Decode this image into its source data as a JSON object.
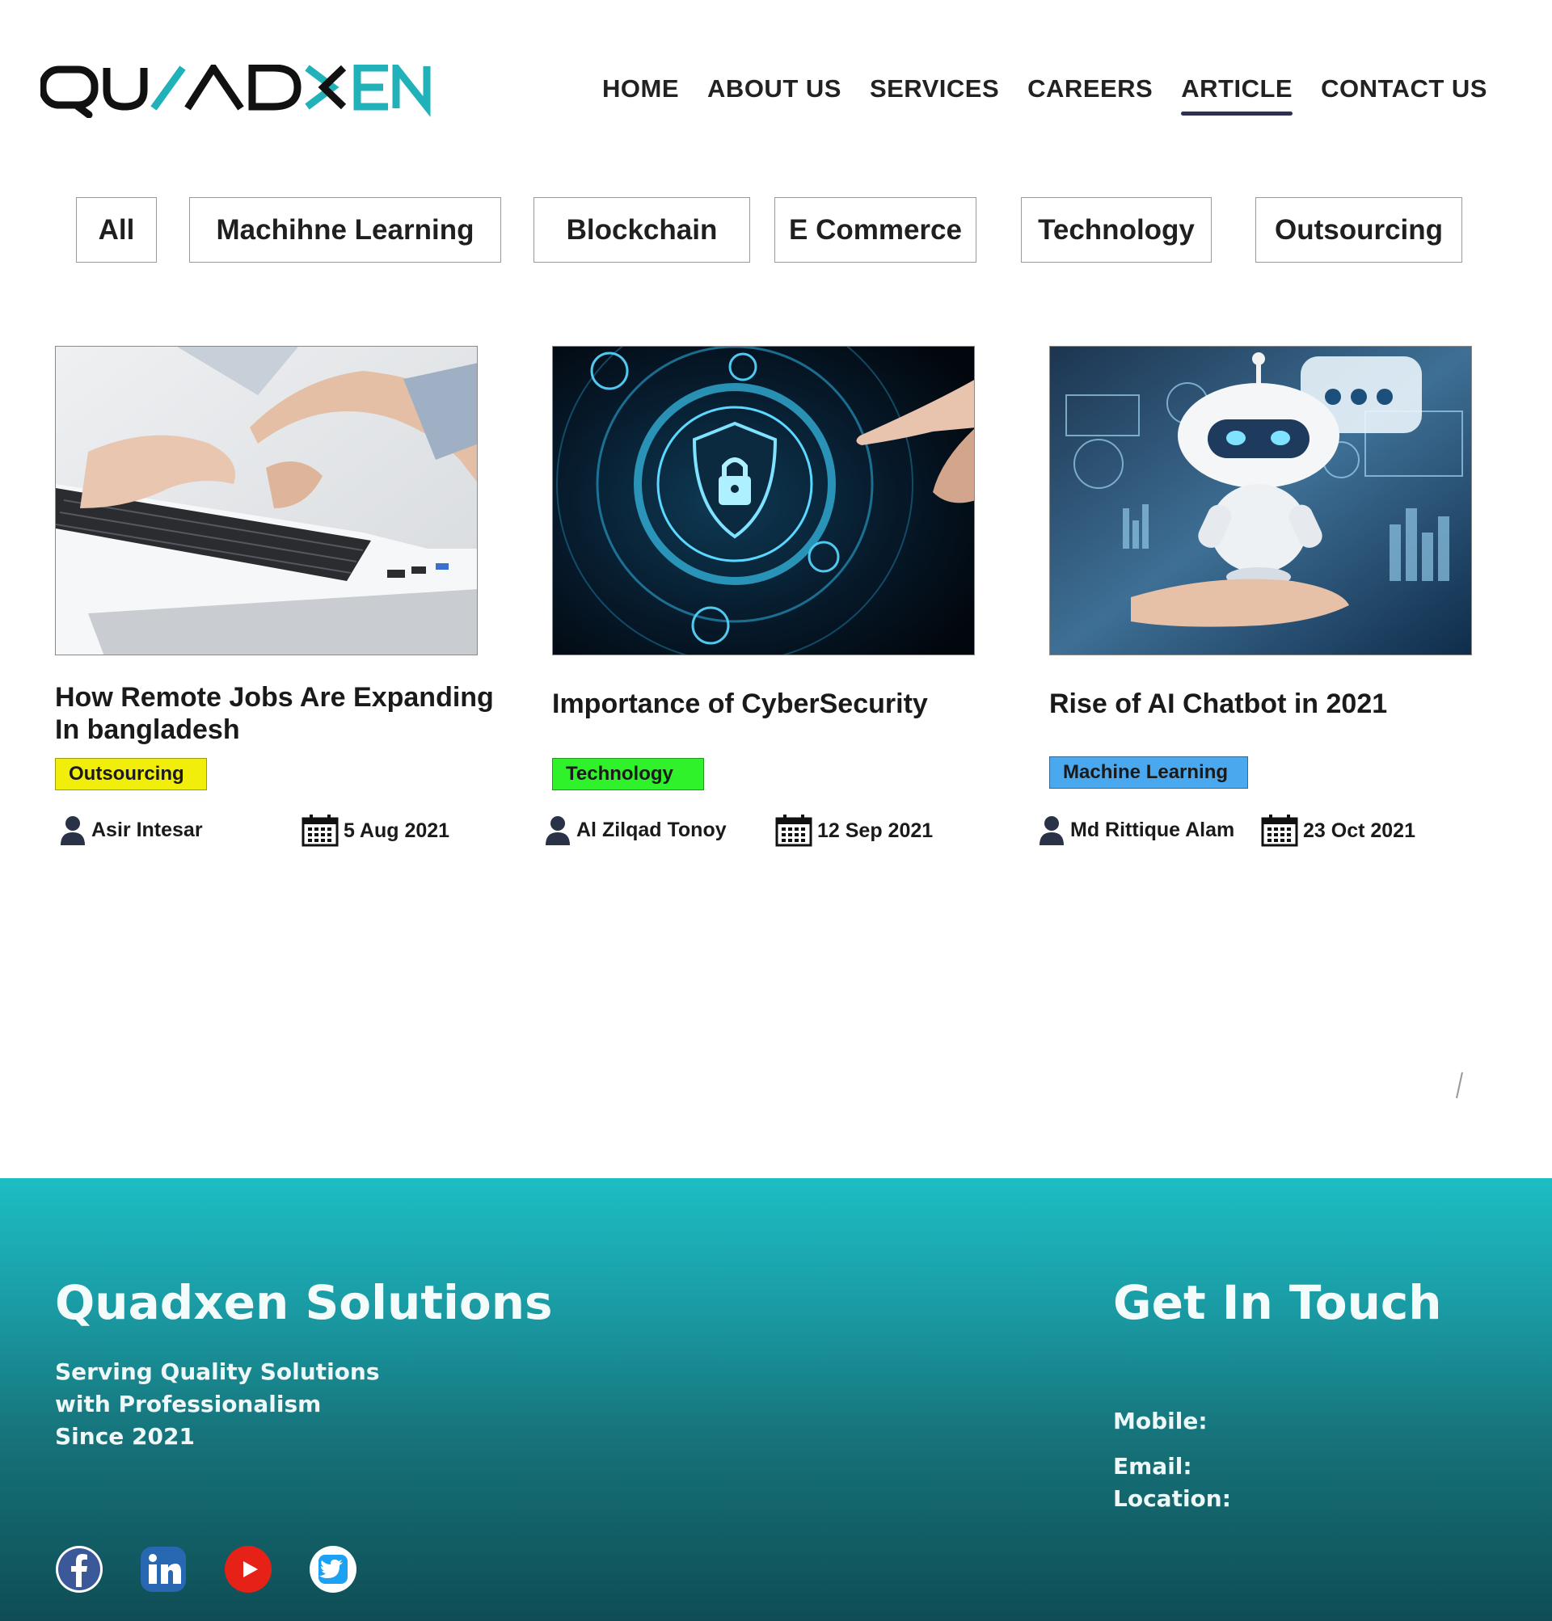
{
  "header": {
    "logo_text": "QUADXEN",
    "nav": [
      {
        "label": "HOME",
        "active": false
      },
      {
        "label": "ABOUT US",
        "active": false
      },
      {
        "label": "SERVICES",
        "active": false
      },
      {
        "label": "CAREERS",
        "active": false
      },
      {
        "label": "ARTICLE",
        "active": true
      },
      {
        "label": "CONTACT US",
        "active": false
      }
    ]
  },
  "filters": [
    "All",
    "Machihne Learning",
    "Blockchain",
    "E Commerce",
    "Technology",
    "Outsourcing"
  ],
  "articles": [
    {
      "title_line1": "How Remote Jobs Are Expanding",
      "title_line2": "In bangladesh",
      "category": "Outsourcing",
      "category_color": "#f2ee0b",
      "author": "Asir Intesar",
      "date": "5 Aug 2021",
      "image": "laptop-typing-image"
    },
    {
      "title_line1": "Importance of CyberSecurity",
      "category": "Technology",
      "category_color": "#2ff22a",
      "author": "Al Zilqad Tonoy",
      "date": "12 Sep 2021",
      "image": "cybersecurity-lock-image"
    },
    {
      "title_line1": "Rise of AI Chatbot in 2021",
      "category": "Machine Learning",
      "category_color": "#4aa8ee",
      "author": "Md Rittique Alam",
      "date": "23 Oct 2021",
      "image": "ai-chatbot-robot-image"
    }
  ],
  "footer": {
    "company": "Quadxen Solutions",
    "tagline": [
      "Serving Quality Solutions",
      "with Professionalism",
      "Since 2021"
    ],
    "contact_title": "Get In Touch",
    "mobile_label": "Mobile:",
    "email_label": "Email:",
    "location_label": "Location:",
    "social": [
      "facebook-icon",
      "linkedin-icon",
      "youtube-icon",
      "twitter-icon"
    ]
  },
  "colors": {
    "brand_dark": "#111111",
    "brand_teal": "#20b2b8",
    "nav_underline": "#2f2f4f",
    "footer_top": "#1dbdc4",
    "footer_bottom": "#0f4d55"
  }
}
